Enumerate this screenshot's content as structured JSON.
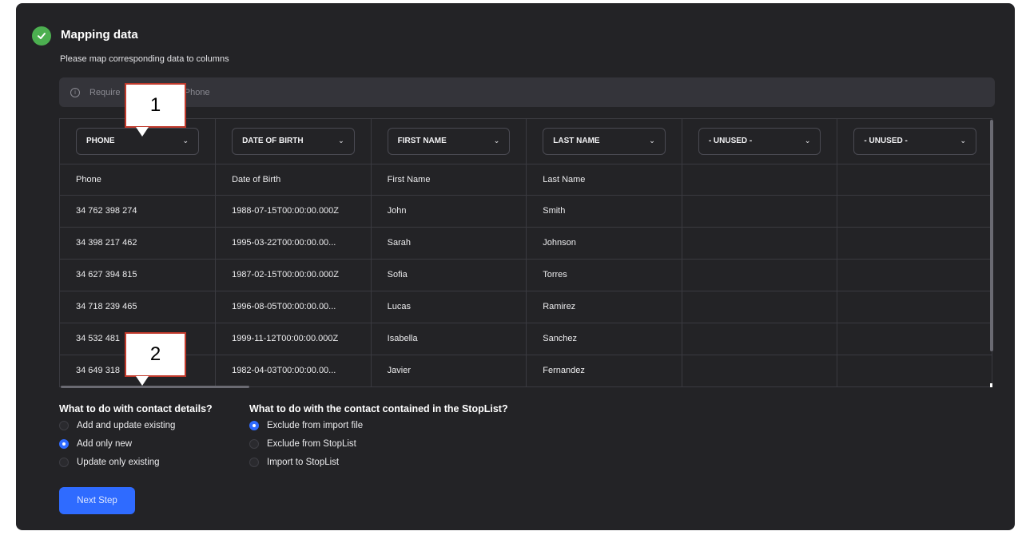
{
  "header": {
    "title": "Mapping data",
    "subtitle": "Please map corresponding data to columns"
  },
  "info_bar": {
    "text_start": "Require",
    "text_end": "o: Phone"
  },
  "column_selects": [
    {
      "label": "PHONE"
    },
    {
      "label": "DATE OF BIRTH"
    },
    {
      "label": "FIRST NAME"
    },
    {
      "label": "LAST NAME"
    },
    {
      "label": "- UNUSED -"
    },
    {
      "label": "- UNUSED -"
    }
  ],
  "headers": [
    "Phone",
    "Date of Birth",
    "First Name",
    "Last Name",
    "",
    ""
  ],
  "rows": [
    [
      "34 762 398 274",
      "1988-07-15T00:00:00.000Z",
      "John",
      "Smith",
      "",
      ""
    ],
    [
      "34 398 217 462",
      "1995-03-22T00:00:00.00...",
      "Sarah",
      "Johnson",
      "",
      ""
    ],
    [
      "34 627 394 815",
      "1987-02-15T00:00:00.000Z",
      "Sofia",
      "Torres",
      "",
      ""
    ],
    [
      "34 718 239 465",
      "1996-08-05T00:00:00.00...",
      "Lucas",
      "Ramirez",
      "",
      ""
    ],
    [
      "34 532 481",
      "1999-11-12T00:00:00.000Z",
      "Isabella",
      "Sanchez",
      "",
      ""
    ],
    [
      "34 649 318",
      "1982-04-03T00:00:00.00...",
      "Javier",
      "Fernandez",
      "",
      ""
    ]
  ],
  "contact_details": {
    "title": "What to do with contact details?",
    "options": [
      {
        "label": "Add and update existing",
        "selected": false
      },
      {
        "label": "Add only new",
        "selected": true
      },
      {
        "label": "Update only existing",
        "selected": false
      }
    ]
  },
  "stoplist": {
    "title": "What to do with the contact contained in the StopList?",
    "options": [
      {
        "label": "Exclude from import file",
        "selected": true
      },
      {
        "label": "Exclude from StopList",
        "selected": false
      },
      {
        "label": "Import to StopList",
        "selected": false
      }
    ]
  },
  "next_button": "Next Step",
  "callouts": [
    {
      "text": "1"
    },
    {
      "text": "2"
    }
  ],
  "colors": {
    "accent": "#2f6bff",
    "success": "#4caf50",
    "panel": "#232326",
    "callout_border": "#c0392b"
  }
}
